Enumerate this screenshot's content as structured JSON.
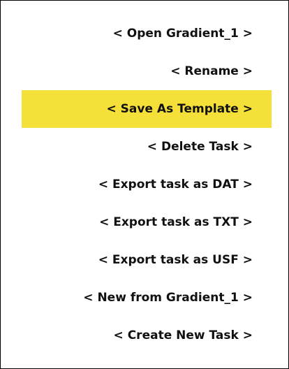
{
  "menu": {
    "selected_index": 2,
    "highlight_color": "#f5e03a",
    "items": [
      {
        "label": "< Open Gradient_1 >"
      },
      {
        "label": "< Rename >"
      },
      {
        "label": "< Save As Template >"
      },
      {
        "label": "< Delete Task >"
      },
      {
        "label": "< Export task as DAT >"
      },
      {
        "label": "< Export task as TXT >"
      },
      {
        "label": "< Export task as USF >"
      },
      {
        "label": "< New from Gradient_1 >"
      },
      {
        "label": "< Create New Task >"
      }
    ]
  }
}
